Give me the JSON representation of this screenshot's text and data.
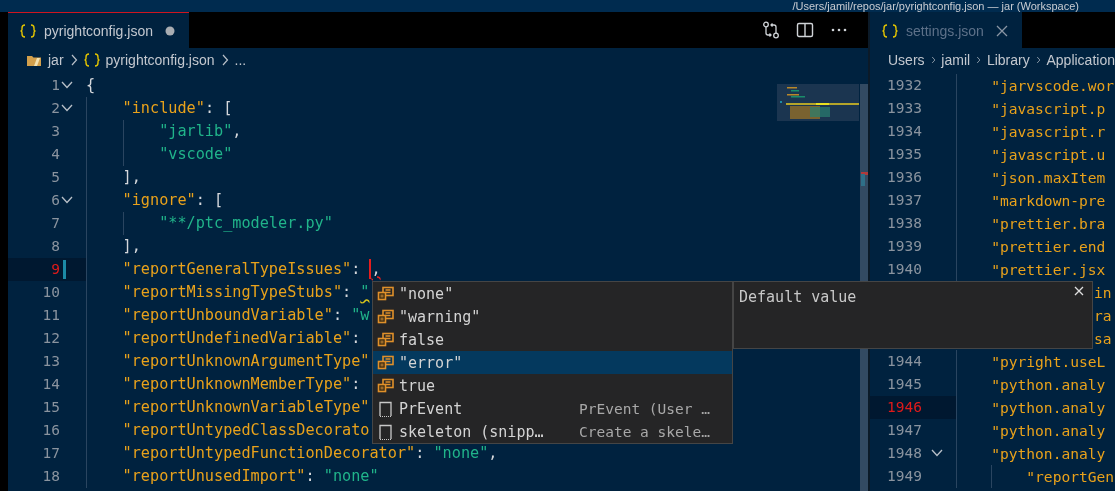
{
  "title_bar": {
    "title": "/Users/jamil/repos/jar/pyrightconfig.json — jar (Workspace)"
  },
  "editor_groups": [
    {
      "tab": {
        "label": "pyrightconfig.json",
        "selected": true,
        "dirty": true
      },
      "breadcrumb": [
        {
          "label": "jar",
          "kind": "folder"
        },
        {
          "label": "pyrightconfig.json",
          "kind": "json"
        },
        {
          "label": "...",
          "kind": "plain"
        }
      ],
      "lines": [
        {
          "kind": "code",
          "n": "1",
          "fold": true,
          "current": false,
          "modified": false,
          "tokens": [
            {
              "text": "{",
              "kind": "punct"
            }
          ]
        },
        {
          "kind": "code",
          "n": "2",
          "fold": true,
          "current": false,
          "modified": false,
          "tokens": [
            {
              "text": "    \"include\"",
              "kind": "key"
            },
            {
              "text": ": [",
              "kind": "punct"
            }
          ]
        },
        {
          "kind": "code",
          "n": "3",
          "fold": false,
          "current": false,
          "modified": false,
          "tokens": [
            {
              "text": "        \"jarlib\"",
              "kind": "str"
            },
            {
              "text": ",",
              "kind": "punct"
            }
          ]
        },
        {
          "kind": "code",
          "n": "4",
          "fold": false,
          "current": false,
          "modified": false,
          "tokens": [
            {
              "text": "        \"vscode\"",
              "kind": "str"
            }
          ]
        },
        {
          "kind": "code",
          "n": "5",
          "fold": false,
          "current": false,
          "modified": false,
          "tokens": [
            {
              "text": "    ],",
              "kind": "punct"
            }
          ]
        },
        {
          "kind": "code",
          "n": "6",
          "fold": true,
          "current": false,
          "modified": false,
          "tokens": [
            {
              "text": "    \"ignore\"",
              "kind": "key"
            },
            {
              "text": ": [",
              "kind": "punct"
            }
          ]
        },
        {
          "kind": "code",
          "n": "7",
          "fold": false,
          "current": false,
          "modified": false,
          "tokens": [
            {
              "text": "        \"**/ptc_modeler.py\"",
              "kind": "str"
            }
          ]
        },
        {
          "kind": "code",
          "n": "8",
          "fold": false,
          "current": false,
          "modified": false,
          "tokens": [
            {
              "text": "    ],",
              "kind": "punct"
            }
          ]
        },
        {
          "kind": "code",
          "n": "9",
          "fold": false,
          "current": true,
          "modified": true,
          "tokens": [
            {
              "text": "    \"reportGeneralTypeIssues\"",
              "kind": "key"
            },
            {
              "text": ": ",
              "kind": "punct"
            },
            {
              "kind": "cursor"
            },
            {
              "text": ",",
              "kind": "punct",
              "error": true
            }
          ]
        },
        {
          "kind": "code",
          "n": "10",
          "fold": false,
          "current": false,
          "modified": false,
          "tokens": [
            {
              "text": "    \"reportMissingTypeStubs\"",
              "kind": "key"
            },
            {
              "text": ": ",
              "kind": "punct"
            },
            {
              "text": "\"",
              "kind": "str",
              "warning": true
            }
          ]
        },
        {
          "kind": "code",
          "n": "11",
          "fold": false,
          "current": false,
          "modified": false,
          "tokens": [
            {
              "text": "    \"reportUnboundVariable\"",
              "kind": "key"
            },
            {
              "text": ": ",
              "kind": "punct"
            },
            {
              "text": "\"w",
              "kind": "str"
            }
          ]
        },
        {
          "kind": "code",
          "n": "12",
          "fold": false,
          "current": false,
          "modified": false,
          "tokens": [
            {
              "text": "    \"reportUndefinedVariable\"",
              "kind": "key"
            },
            {
              "text": ":",
              "kind": "punct"
            }
          ]
        },
        {
          "kind": "code",
          "n": "13",
          "fold": false,
          "current": false,
          "modified": false,
          "tokens": [
            {
              "text": "    \"reportUnknownArgumentType\"",
              "kind": "key"
            }
          ]
        },
        {
          "kind": "code",
          "n": "14",
          "fold": false,
          "current": false,
          "modified": false,
          "tokens": [
            {
              "text": "    \"reportUnknownMemberType\"",
              "kind": "key"
            },
            {
              "text": ":",
              "kind": "punct"
            }
          ]
        },
        {
          "kind": "code",
          "n": "15",
          "fold": false,
          "current": false,
          "modified": false,
          "tokens": [
            {
              "text": "    \"reportUnknownVariableType\"",
              "kind": "key"
            }
          ]
        },
        {
          "kind": "code",
          "n": "16",
          "fold": false,
          "current": false,
          "modified": false,
          "tokens": [
            {
              "text": "    \"reportUntypedClassDecorato",
              "kind": "key"
            }
          ]
        },
        {
          "kind": "code",
          "n": "17",
          "fold": false,
          "current": false,
          "modified": false,
          "tokens": [
            {
              "text": "    \"reportUntypedFunctionDecorator\"",
              "kind": "key"
            },
            {
              "text": ": ",
              "kind": "punct"
            },
            {
              "text": "\"none\"",
              "kind": "str"
            },
            {
              "text": ",",
              "kind": "punct"
            }
          ]
        },
        {
          "kind": "code",
          "n": "18",
          "fold": false,
          "current": false,
          "modified": false,
          "tokens": [
            {
              "text": "    \"reportUnusedImport\"",
              "kind": "key"
            },
            {
              "text": ": ",
              "kind": "punct"
            },
            {
              "text": "\"none\"",
              "kind": "str"
            }
          ]
        }
      ]
    },
    {
      "tab": {
        "label": "settings.json",
        "selected": false,
        "dirty": false
      },
      "breadcrumb": [
        {
          "label": "Users",
          "kind": "plain"
        },
        {
          "label": "jamil",
          "kind": "plain"
        },
        {
          "label": "Library",
          "kind": "plain"
        },
        {
          "label": "Application",
          "kind": "plain"
        }
      ],
      "lines": [
        {
          "kind": "code",
          "n": "1932",
          "fold": false,
          "current": false,
          "modified": false,
          "tokens": [
            {
              "text": "    \"jarvscode.wor",
              "kind": "key"
            }
          ]
        },
        {
          "kind": "code",
          "n": "1933",
          "fold": false,
          "current": false,
          "modified": false,
          "tokens": [
            {
              "text": "    \"javascript.p",
              "kind": "key"
            }
          ]
        },
        {
          "kind": "code",
          "n": "1934",
          "fold": false,
          "current": false,
          "modified": false,
          "tokens": [
            {
              "text": "    \"javascript.r",
              "kind": "key"
            }
          ]
        },
        {
          "kind": "code",
          "n": "1935",
          "fold": false,
          "current": false,
          "modified": false,
          "tokens": [
            {
              "text": "    \"javascript.u",
              "kind": "key"
            }
          ]
        },
        {
          "kind": "code",
          "n": "1936",
          "fold": false,
          "current": false,
          "modified": false,
          "tokens": [
            {
              "text": "    \"json.maxItem",
              "kind": "key"
            }
          ]
        },
        {
          "kind": "code",
          "n": "1937",
          "fold": false,
          "current": false,
          "modified": false,
          "tokens": [
            {
              "text": "    \"markdown-pre",
              "kind": "key"
            }
          ]
        },
        {
          "kind": "code",
          "n": "1938",
          "fold": false,
          "current": false,
          "modified": false,
          "tokens": [
            {
              "text": "    \"prettier.bra",
              "kind": "key"
            }
          ]
        },
        {
          "kind": "code",
          "n": "1939",
          "fold": false,
          "current": false,
          "modified": false,
          "tokens": [
            {
              "text": "    \"prettier.end",
              "kind": "key"
            }
          ]
        },
        {
          "kind": "code",
          "n": "1940",
          "fold": false,
          "current": false,
          "modified": false,
          "tokens": [
            {
              "text": "    \"prettier.jsx",
              "kind": "key"
            }
          ]
        },
        {
          "kind": "covered",
          "tokens": [
            {
              "text": "in",
              "kind": "key"
            }
          ]
        },
        {
          "kind": "covered",
          "tokens": [
            {
              "text": "ra",
              "kind": "key"
            }
          ]
        },
        {
          "kind": "covered",
          "tokens": [
            {
              "text": "sa",
              "kind": "key"
            }
          ]
        },
        {
          "kind": "code",
          "n": "1944",
          "fold": false,
          "current": false,
          "modified": false,
          "tokens": [
            {
              "text": "    \"pyright.useL",
              "kind": "key"
            }
          ]
        },
        {
          "kind": "code",
          "n": "1945",
          "fold": false,
          "current": false,
          "modified": false,
          "tokens": [
            {
              "text": "    \"python.analy",
              "kind": "key"
            }
          ]
        },
        {
          "kind": "code",
          "n": "1946",
          "fold": false,
          "current": true,
          "modified": false,
          "tokens": [
            {
              "text": "    \"python.analy",
              "kind": "key"
            }
          ]
        },
        {
          "kind": "code",
          "n": "1947",
          "fold": false,
          "current": false,
          "modified": false,
          "tokens": [
            {
              "text": "    \"python.analy",
              "kind": "key"
            }
          ]
        },
        {
          "kind": "code",
          "n": "1948",
          "fold": true,
          "current": false,
          "modified": false,
          "tokens": [
            {
              "text": "    \"python.analy",
              "kind": "key"
            }
          ]
        },
        {
          "kind": "code",
          "n": "1949",
          "fold": false,
          "current": false,
          "modified": false,
          "tokens": [
            {
              "text": "        \"reportGen",
              "kind": "key"
            }
          ]
        }
      ]
    }
  ],
  "suggest": {
    "items": [
      {
        "label": "\"none\"",
        "kind": "value",
        "selected": false
      },
      {
        "label": "\"warning\"",
        "kind": "value",
        "selected": false
      },
      {
        "label": "false",
        "kind": "value",
        "selected": false
      },
      {
        "label": "\"error\"",
        "kind": "value",
        "selected": true
      },
      {
        "label": "true",
        "kind": "value",
        "selected": false
      },
      {
        "label": "PrEvent",
        "kind": "snippet",
        "detail": "PrEvent (User …",
        "selected": false
      },
      {
        "label": "skeleton (snipp…",
        "kind": "snippet",
        "detail": "Create a skele…",
        "selected": false
      }
    ]
  },
  "details": {
    "text": "Default value"
  }
}
